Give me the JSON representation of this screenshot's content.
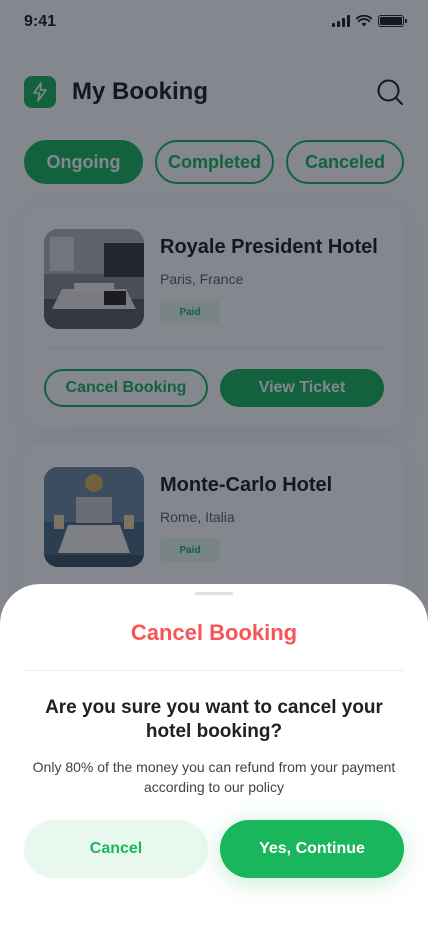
{
  "status_bar": {
    "time": "9:41"
  },
  "header": {
    "title": "My Booking",
    "logo_icon": "bolt-icon",
    "search_icon": "search-icon"
  },
  "tabs": [
    {
      "label": "Ongoing",
      "active": true
    },
    {
      "label": "Completed",
      "active": false
    },
    {
      "label": "Canceled",
      "active": false
    }
  ],
  "bookings": [
    {
      "name": "Royale President Hotel",
      "location": "Paris, France",
      "status": "Paid",
      "cancel_label": "Cancel Booking",
      "ticket_label": "View Ticket"
    },
    {
      "name": "Monte-Carlo Hotel",
      "location": "Rome, Italia",
      "status": "Paid"
    }
  ],
  "dialog": {
    "title": "Cancel Booking",
    "question": "Are you sure you want to cancel your hotel booking?",
    "note": "Only 80% of the money you can refund from your payment according to our policy",
    "cancel_label": "Cancel",
    "confirm_label": "Yes, Continue"
  },
  "colors": {
    "primary": "#1ab65c",
    "danger": "#f75555",
    "text": "#212121",
    "badge_bg": "#e8f8ef"
  }
}
